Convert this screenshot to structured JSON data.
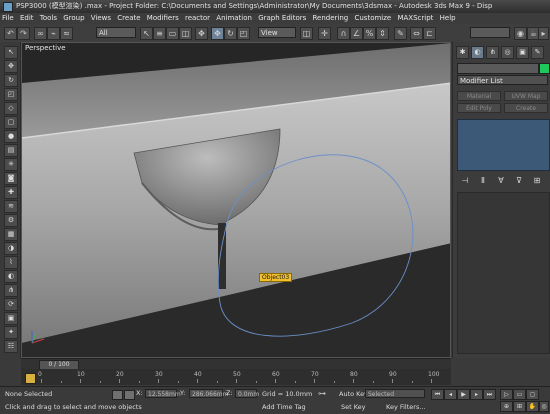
{
  "window": {
    "title": "PSP3000 (模型渲染) .max   - Project Folder: C:\\Documents and Settings\\Administrator\\My Documents\\3dsmax   - Autodesk 3ds Max 9   - Disp"
  },
  "menu": [
    "File",
    "Edit",
    "Tools",
    "Group",
    "Views",
    "Create",
    "Modifiers",
    "reactor",
    "Animation",
    "Graph Editors",
    "Rendering",
    "Customize",
    "MAXScript",
    "Help"
  ],
  "toolbar": {
    "selection_filter": "All",
    "coord_system": "View"
  },
  "viewport": {
    "label": "Perspective",
    "object_tooltip": "Object03"
  },
  "command_panel": {
    "modifier_list": "Modifier List",
    "buttons": [
      "Material",
      "UVW Map",
      "Edit Poly",
      "Create"
    ],
    "swatch_color": "#1ec85a"
  },
  "timeline": {
    "frame_display": "0 / 100",
    "ticks": [
      "0",
      "10",
      "20",
      "30",
      "40",
      "50",
      "60",
      "70",
      "80",
      "90",
      "100"
    ]
  },
  "status": {
    "selection": "None Selected",
    "prompt": "Click and drag to select and move objects",
    "x_label": "X:",
    "x_value": "12.558mm",
    "y_label": "Y:",
    "y_value": "286.066mm",
    "z_label": "Z:",
    "z_value": "0.0mm",
    "grid": "Grid = 10.0mm",
    "add_time_tag": "Add Time Tag",
    "auto_key": "Auto Key",
    "set_key": "Set Key",
    "selected_dropdown": "Selected",
    "key_filters": "Key Filters..."
  }
}
